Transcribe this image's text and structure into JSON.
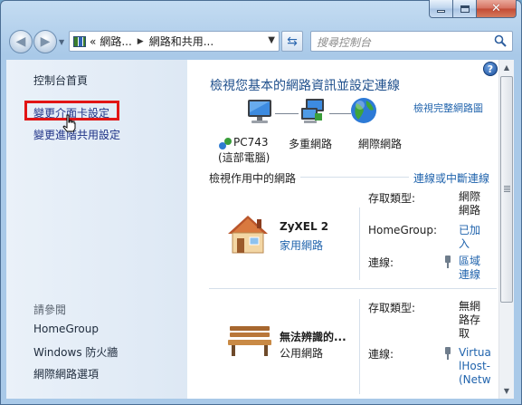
{
  "window": {
    "caption_buttons": {
      "minimize": "minimize",
      "maximize": "maximize",
      "close": "✕"
    }
  },
  "nav": {
    "address_segments": [
      "«",
      "網路...",
      "網路和共用..."
    ],
    "search_placeholder": "搜尋控制台"
  },
  "sidebar": {
    "home": "控制台首頁",
    "change_adapter": "變更介面卡設定",
    "advanced_sharing": "變更進階共用設定",
    "see_also": "請參閱",
    "see_also_items": [
      "HomeGroup",
      "Windows 防火牆",
      "網際網路選項"
    ]
  },
  "main": {
    "title": "檢視您基本的網路資訊並設定連線",
    "full_map_link": "檢視完整網路圖",
    "map": {
      "computer_name": "PC743",
      "computer_sub": "(這部電腦)",
      "multi_network": "多重網路",
      "internet": "網際網路"
    },
    "active_title": "檢視作用中的網路",
    "connect_link": "連線或中斷連線",
    "networks": [
      {
        "name": "ZyXEL 2",
        "type": "家用網路",
        "access_label": "存取類型:",
        "access_value": "網際網路",
        "homegroup_label": "HomeGroup:",
        "homegroup_value": "已加入",
        "conn_label": "連線:",
        "conn_value": "區域連線"
      },
      {
        "name": "無法辨識的...",
        "type": "公用網路",
        "access_label": "存取類型:",
        "access_value": "無網路存取",
        "conn_label": "連線:",
        "conn_value": "VirtualHost-(Netwo"
      }
    ]
  },
  "colors": {
    "link": "#2164ad",
    "title": "#1e4f8c",
    "highlight": "#e11515"
  }
}
